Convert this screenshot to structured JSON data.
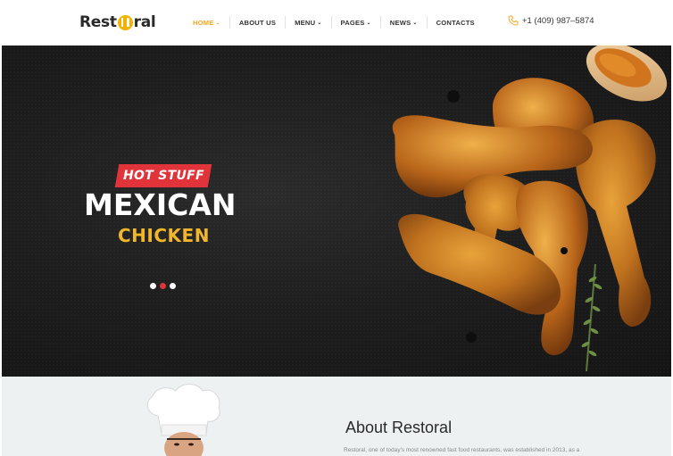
{
  "header": {
    "logo_prefix": "Rest",
    "logo_suffix": "ral",
    "nav": [
      {
        "label": "HOME",
        "dropdown": true,
        "active": true
      },
      {
        "label": "ABOUT US",
        "dropdown": false,
        "active": false
      },
      {
        "label": "MENU",
        "dropdown": true,
        "active": false
      },
      {
        "label": "PAGES",
        "dropdown": true,
        "active": false
      },
      {
        "label": "NEWS",
        "dropdown": true,
        "active": false
      },
      {
        "label": "CONTACTS",
        "dropdown": false,
        "active": false
      }
    ],
    "phone": "+1 (409) 987–5874",
    "phone_icon": "phone-icon"
  },
  "hero": {
    "badge": "HOT STUFF",
    "title": "MEXICAN",
    "subtitle": "CHICKEN",
    "slides": 3,
    "active_slide": 2
  },
  "about": {
    "title": "About Restoral",
    "text": "Restoral, one of today's most renowned fast food restaurants, was established in 2013, as a"
  },
  "colors": {
    "accent": "#f5a623",
    "badge": "#e0343a",
    "subtitle": "#f2b62a",
    "hero_bg": "#1e1e1e",
    "about_bg": "#eef1f2"
  }
}
